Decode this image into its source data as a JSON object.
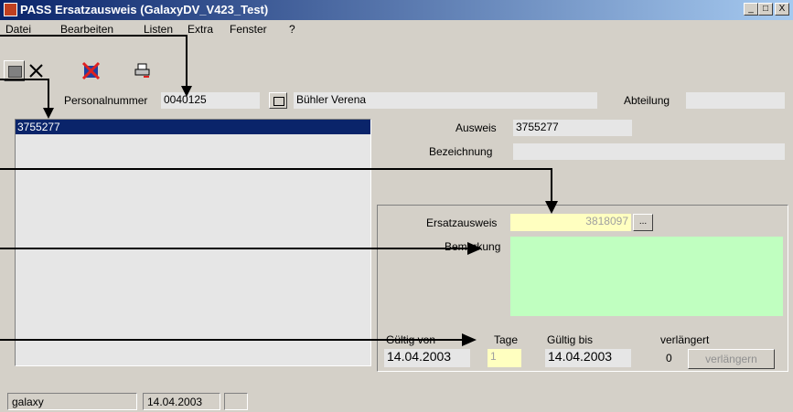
{
  "window": {
    "title": "PASS Ersatzausweis (GalaxyDV_V423_Test)",
    "min_btn": "_",
    "max_btn": "□",
    "close_btn": "X"
  },
  "menu": [
    "Datei",
    "Bearbeiten",
    "Listen",
    "Extra",
    "Fenster",
    "?"
  ],
  "toolbar": {
    "icons": [
      "save-icon",
      "delete-icon",
      "cancel-icon",
      "print-icon"
    ]
  },
  "header": {
    "personalnummer_label": "Personalnummer",
    "personalnummer_value": "0040125",
    "name_value": "Bühler Verena",
    "abteilung_label": "Abteilung",
    "abteilung_value": ""
  },
  "list": {
    "items": [
      "3755277"
    ],
    "selected_index": 0
  },
  "detail": {
    "ausweis_label": "Ausweis",
    "ausweis_value": "3755277",
    "bezeichnung_label": "Bezeichnung",
    "bezeichnung_value": ""
  },
  "panel": {
    "ersatzausweis_label": "Ersatzausweis",
    "ersatzausweis_value": "3818097",
    "lookup_button": "...",
    "bemerkung_label": "Bemerkung",
    "bemerkung_value": "",
    "gueltig_von_label": "Gültig von",
    "gueltig_von_value": "14.04.2003",
    "tage_label": "Tage",
    "tage_value": "1",
    "gueltig_bis_label": "Gültig bis",
    "gueltig_bis_value": "14.04.2003",
    "verlaengert_label": "verlängert",
    "verlaengert_value": "0",
    "verlaengern_button": "verlängern"
  },
  "statusbar": {
    "user": "galaxy",
    "date": "14.04.2003",
    "extra": ""
  },
  "colors": {
    "titlebar_start": "#0a246a",
    "selection": "#0a246a",
    "ersatz_field": "#ffffc0",
    "bemerkung_field": "#c0ffc0"
  }
}
